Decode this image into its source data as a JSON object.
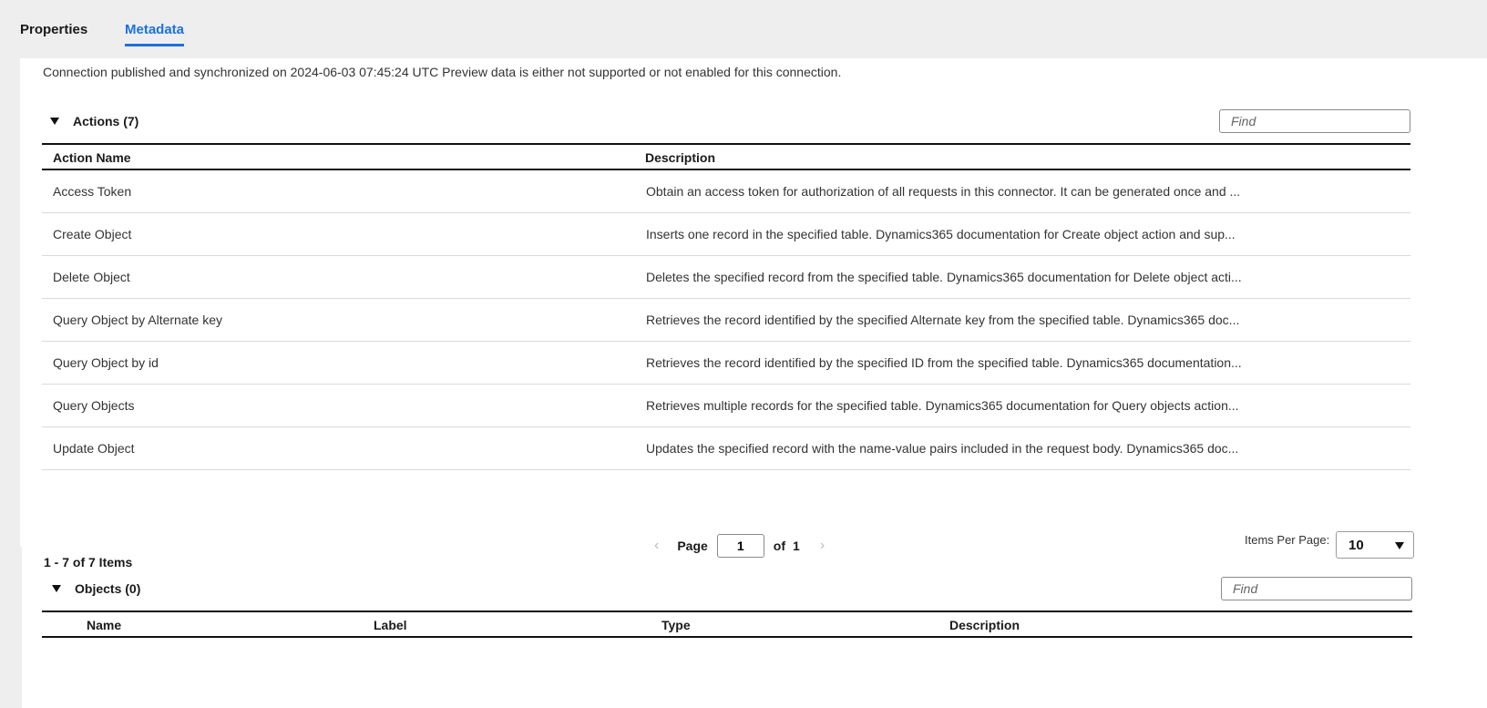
{
  "tabs": [
    {
      "label": "Properties",
      "active": false
    },
    {
      "label": "Metadata",
      "active": true
    }
  ],
  "accent_color": "#1f6fe0",
  "sync_message": "Connection published and synchronized on 2024-06-03 07:45:24 UTC Preview data is either not supported or not enabled for this connection.",
  "actions": {
    "title": "Actions (7)",
    "expanded": true,
    "find_placeholder": "Find",
    "columns": [
      "Action Name",
      "Description"
    ],
    "rows": [
      {
        "name": "Access Token",
        "description": "Obtain an access token for authorization of all requests in this connector. It can be generated once and ..."
      },
      {
        "name": "Create Object",
        "description": "Inserts one record in the specified table. Dynamics365 documentation for Create object action and sup..."
      },
      {
        "name": "Delete Object",
        "description": "Deletes the specified record from the specified table. Dynamics365 documentation for Delete object acti..."
      },
      {
        "name": "Query Object by Alternate key",
        "description": "Retrieves the record identified by the specified Alternate key from the specified table. Dynamics365 doc..."
      },
      {
        "name": "Query Object by id",
        "description": "Retrieves the record identified by the specified ID from the specified table. Dynamics365 documentation..."
      },
      {
        "name": "Query Objects",
        "description": "Retrieves multiple records for the specified table. Dynamics365 documentation for Query objects action..."
      },
      {
        "name": "Update Object",
        "description": "Updates the specified record with the name-value pairs included in the request body. Dynamics365 doc..."
      }
    ]
  },
  "pagination": {
    "count_text": "1 - 7 of 7 Items",
    "prev_icon": "chevron-left",
    "page_label": "Page",
    "current_page": "1",
    "of_label": "of",
    "total_pages": "1",
    "next_icon": "chevron-right",
    "items_per_page_label": "Items Per Page:",
    "items_per_page": "10"
  },
  "objects": {
    "title": "Objects (0)",
    "expanded": true,
    "find_placeholder": "Find",
    "columns": [
      "Name",
      "Label",
      "Type",
      "Description"
    ],
    "rows": []
  }
}
